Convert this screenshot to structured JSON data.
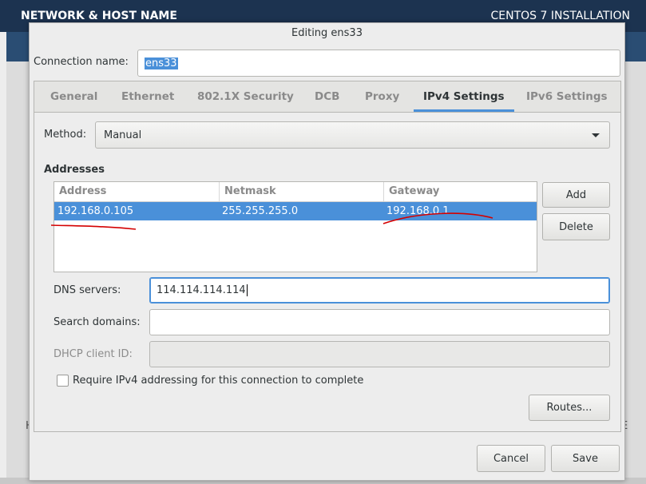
{
  "background": {
    "section_title": "NETWORK & HOST NAME",
    "install_title": "CENTOS 7 INSTALLATION",
    "left_fragment": "H",
    "right_fragment": "E"
  },
  "dialog": {
    "title": "Editing ens33",
    "connection_name_label": "Connection name:",
    "connection_name_value": "ens33",
    "tabs": [
      {
        "label": "General"
      },
      {
        "label": "Ethernet"
      },
      {
        "label": "802.1X Security"
      },
      {
        "label": "DCB"
      },
      {
        "label": "Proxy"
      },
      {
        "label": "IPv4 Settings",
        "active": true
      },
      {
        "label": "IPv6 Settings"
      }
    ],
    "method_label": "Method:",
    "method_value": "Manual",
    "addresses_label": "Addresses",
    "columns": [
      "Address",
      "Netmask",
      "Gateway"
    ],
    "rows": [
      {
        "address": "192.168.0.105",
        "netmask": "255.255.255.0",
        "gateway": "192.168.0.1",
        "selected": true
      }
    ],
    "add_button": "Add",
    "delete_button": "Delete",
    "dns_label": "DNS servers:",
    "dns_value": "114.114.114.114",
    "search_label": "Search domains:",
    "search_value": "",
    "dhcp_label": "DHCP client ID:",
    "dhcp_value": "",
    "require_label": "Require IPv4 addressing for this connection to complete",
    "require_checked": false,
    "routes_button": "Routes...",
    "cancel_button": "Cancel",
    "save_button": "Save"
  },
  "colors": {
    "accent": "#4a90d9",
    "header_bg": "#1c3350",
    "annotation_red": "#d40000"
  }
}
